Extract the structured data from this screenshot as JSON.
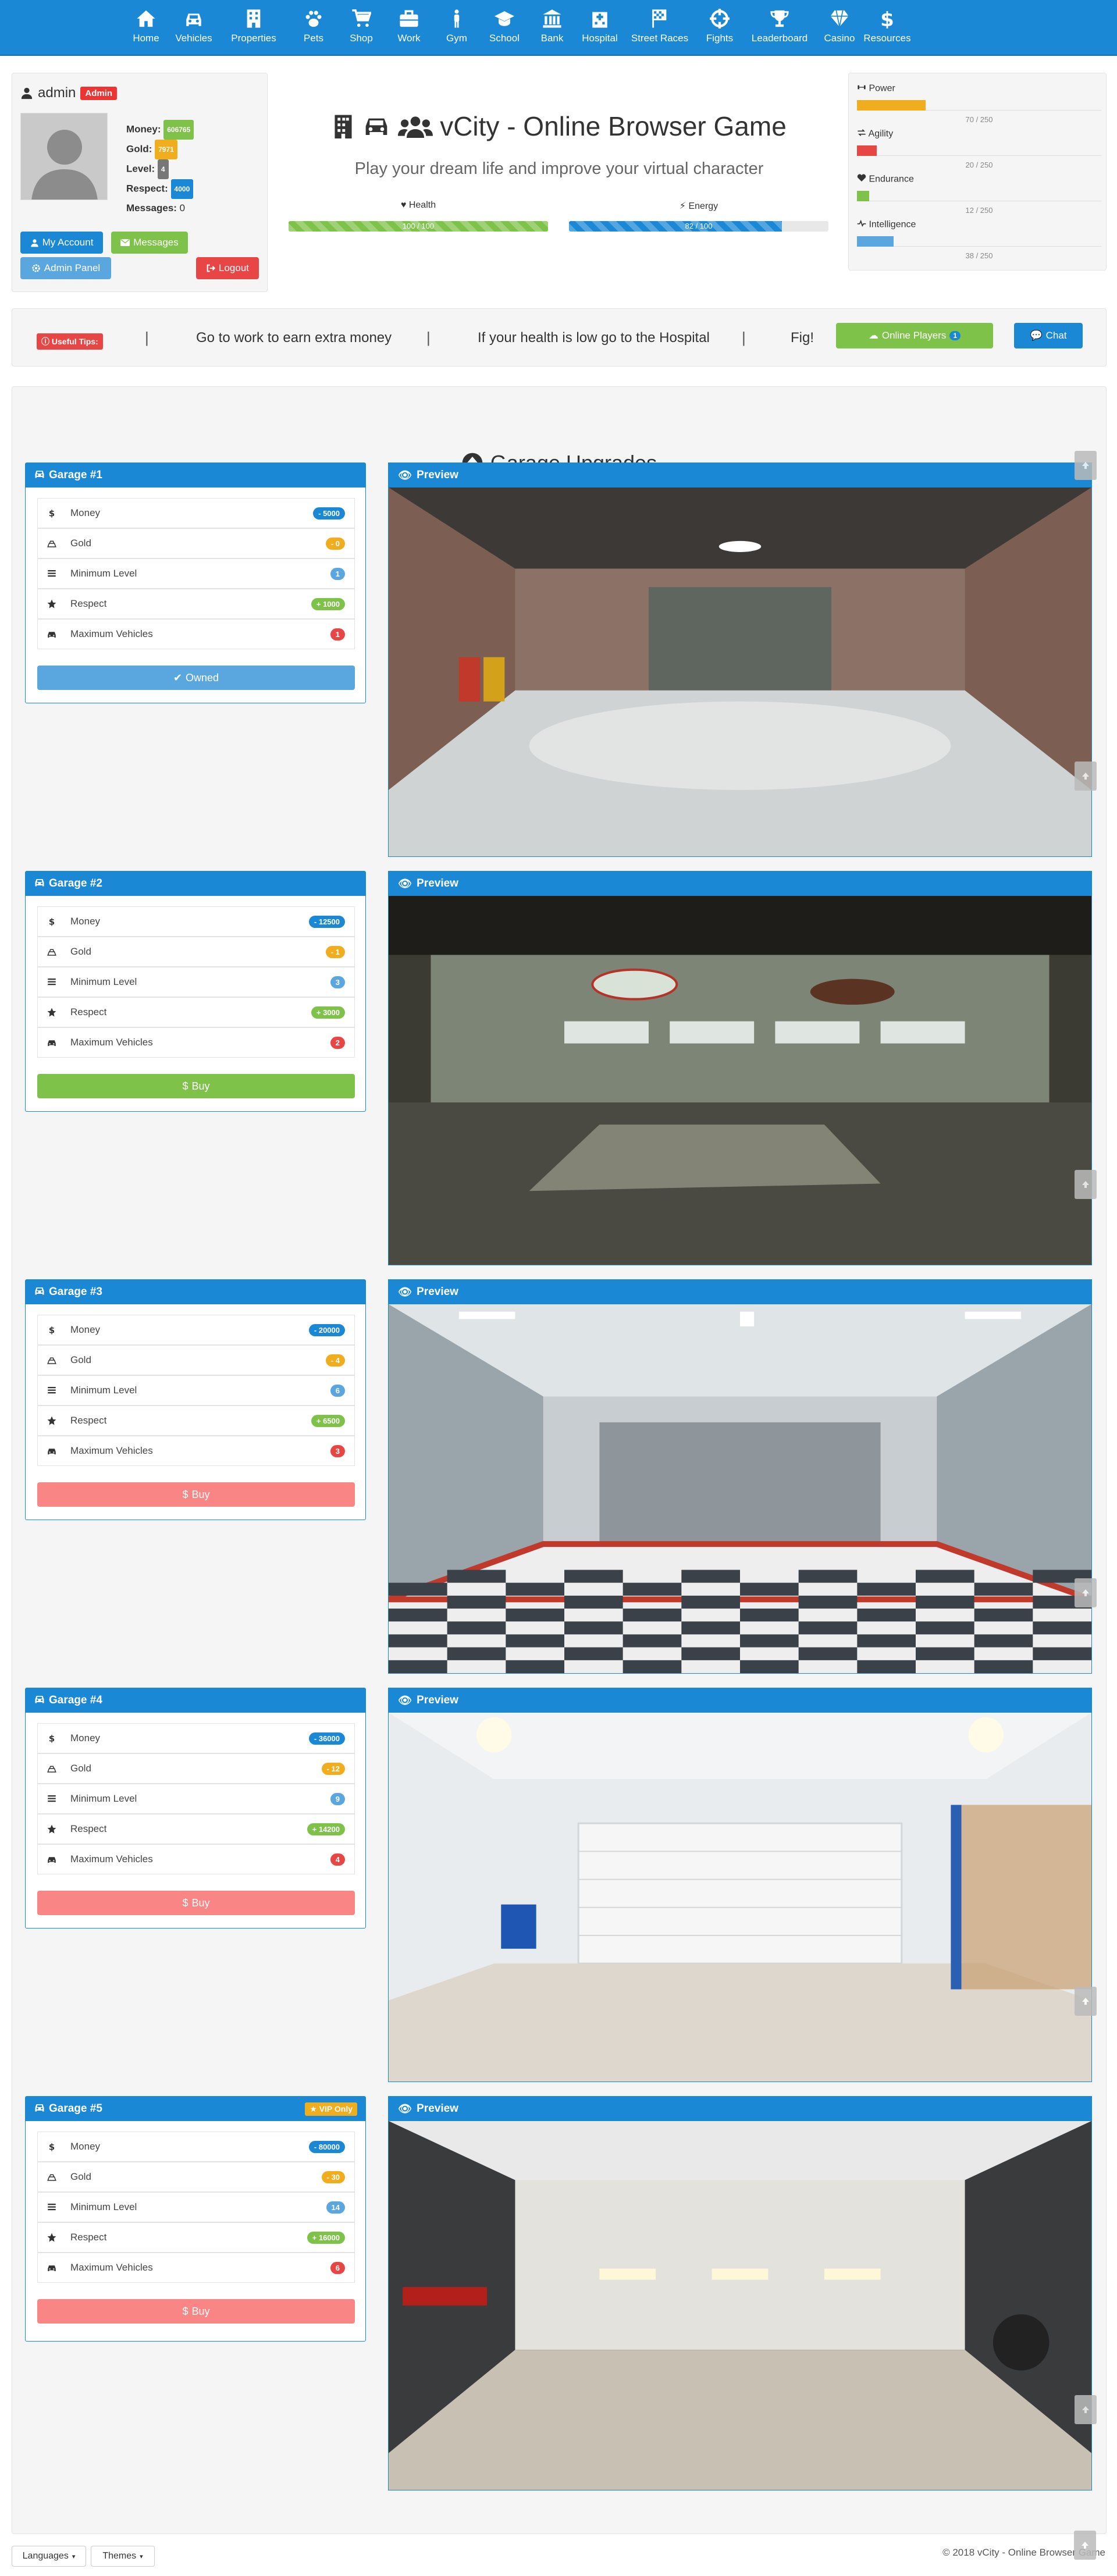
{
  "nav": [
    {
      "label": "Home",
      "icon": "home-icon"
    },
    {
      "label": "Vehicles",
      "icon": "car-icon"
    },
    {
      "label": "Properties",
      "icon": "building-icon"
    },
    {
      "label": "Pets",
      "icon": "paw-icon"
    },
    {
      "label": "Shop",
      "icon": "cart-icon"
    },
    {
      "label": "Work",
      "icon": "briefcase-icon"
    },
    {
      "label": "Gym",
      "icon": "person-icon"
    },
    {
      "label": "School",
      "icon": "graduation-cap-icon"
    },
    {
      "label": "Bank",
      "icon": "bank-icon"
    },
    {
      "label": "Hospital",
      "icon": "hospital-icon"
    },
    {
      "label": "Street Races",
      "icon": "flag-icon"
    },
    {
      "label": "Fights",
      "icon": "crosshair-icon"
    },
    {
      "label": "Leaderboard",
      "icon": "trophy-icon"
    },
    {
      "label": "Casino",
      "icon": "diamond-icon"
    },
    {
      "label": "Resources",
      "icon": "dollar-icon"
    }
  ],
  "user": {
    "name": "admin",
    "role_badge": "Admin",
    "money_label": "Money:",
    "money": "606765",
    "gold_label": "Gold:",
    "gold": "7971",
    "level_label": "Level:",
    "level": "4",
    "respect_label": "Respect:",
    "respect": "4000",
    "messages_label": "Messages:",
    "messages": "0",
    "my_account": "My Account",
    "messages_btn": "Messages",
    "admin_panel": "Admin Panel",
    "logout": "Logout"
  },
  "header": {
    "title": "vCity - Online Browser Game",
    "subtitle": "Play your dream life and improve your virtual character",
    "health_label": "Health",
    "health_text": "100 / 100",
    "health_pct": 100,
    "energy_label": "Energy",
    "energy_text": "82 / 100",
    "energy_pct": 82
  },
  "attributes": [
    {
      "label": "Power",
      "text": "70 / 250",
      "pct": 28,
      "color": "#f0ad1e",
      "icon": "dumbbell-icon"
    },
    {
      "label": "Agility",
      "text": "20 / 250",
      "pct": 8,
      "color": "#e84545",
      "icon": "arrows-icon"
    },
    {
      "label": "Endurance",
      "text": "12 / 250",
      "pct": 5,
      "color": "#7fc24a",
      "icon": "heart-icon"
    },
    {
      "label": "Intelligence",
      "text": "38 / 250",
      "pct": 15,
      "color": "#5aa6df",
      "icon": "brain-icon"
    }
  ],
  "tips": {
    "label": "Useful Tips:",
    "items": [
      "Go to work to earn extra money",
      "If your health is low go to the Hospital",
      "Fig!"
    ],
    "online_players": "Online Players",
    "online_count": "1",
    "chat": "Chat"
  },
  "garage_section": {
    "title": "Garage Upgrades",
    "preview_label": "Preview",
    "req_labels": [
      "Money",
      "Gold",
      "Minimum Level",
      "Respect",
      "Maximum Vehicles"
    ],
    "garages": [
      {
        "name": "Garage #1",
        "money": "- 5000",
        "gold": "- 0",
        "level": "1",
        "respect": "+ 1000",
        "max_vehicles": "1",
        "button": "Owned",
        "button_state": "owned",
        "vip": ""
      },
      {
        "name": "Garage #2",
        "money": "- 12500",
        "gold": "- 1",
        "level": "3",
        "respect": "+ 3000",
        "max_vehicles": "2",
        "button": "Buy",
        "button_state": "buy",
        "vip": ""
      },
      {
        "name": "Garage #3",
        "money": "- 20000",
        "gold": "- 4",
        "level": "6",
        "respect": "+ 6500",
        "max_vehicles": "3",
        "button": "Buy",
        "button_state": "locked",
        "vip": ""
      },
      {
        "name": "Garage #4",
        "money": "- 36000",
        "gold": "- 12",
        "level": "9",
        "respect": "+ 14200",
        "max_vehicles": "4",
        "button": "Buy",
        "button_state": "locked",
        "vip": ""
      },
      {
        "name": "Garage #5",
        "money": "- 80000",
        "gold": "- 30",
        "level": "14",
        "respect": "+ 16000",
        "max_vehicles": "6",
        "button": "Buy",
        "button_state": "locked",
        "vip": "VIP Only"
      }
    ]
  },
  "footer": {
    "languages": "Languages",
    "themes": "Themes",
    "copyright": "© 2018 vCity - Online Browser Game"
  },
  "colors": {
    "primary": "#1a88d4",
    "success": "#7fc24a",
    "danger": "#e84545",
    "warning": "#f0ad1e",
    "info": "#5aa6df"
  }
}
